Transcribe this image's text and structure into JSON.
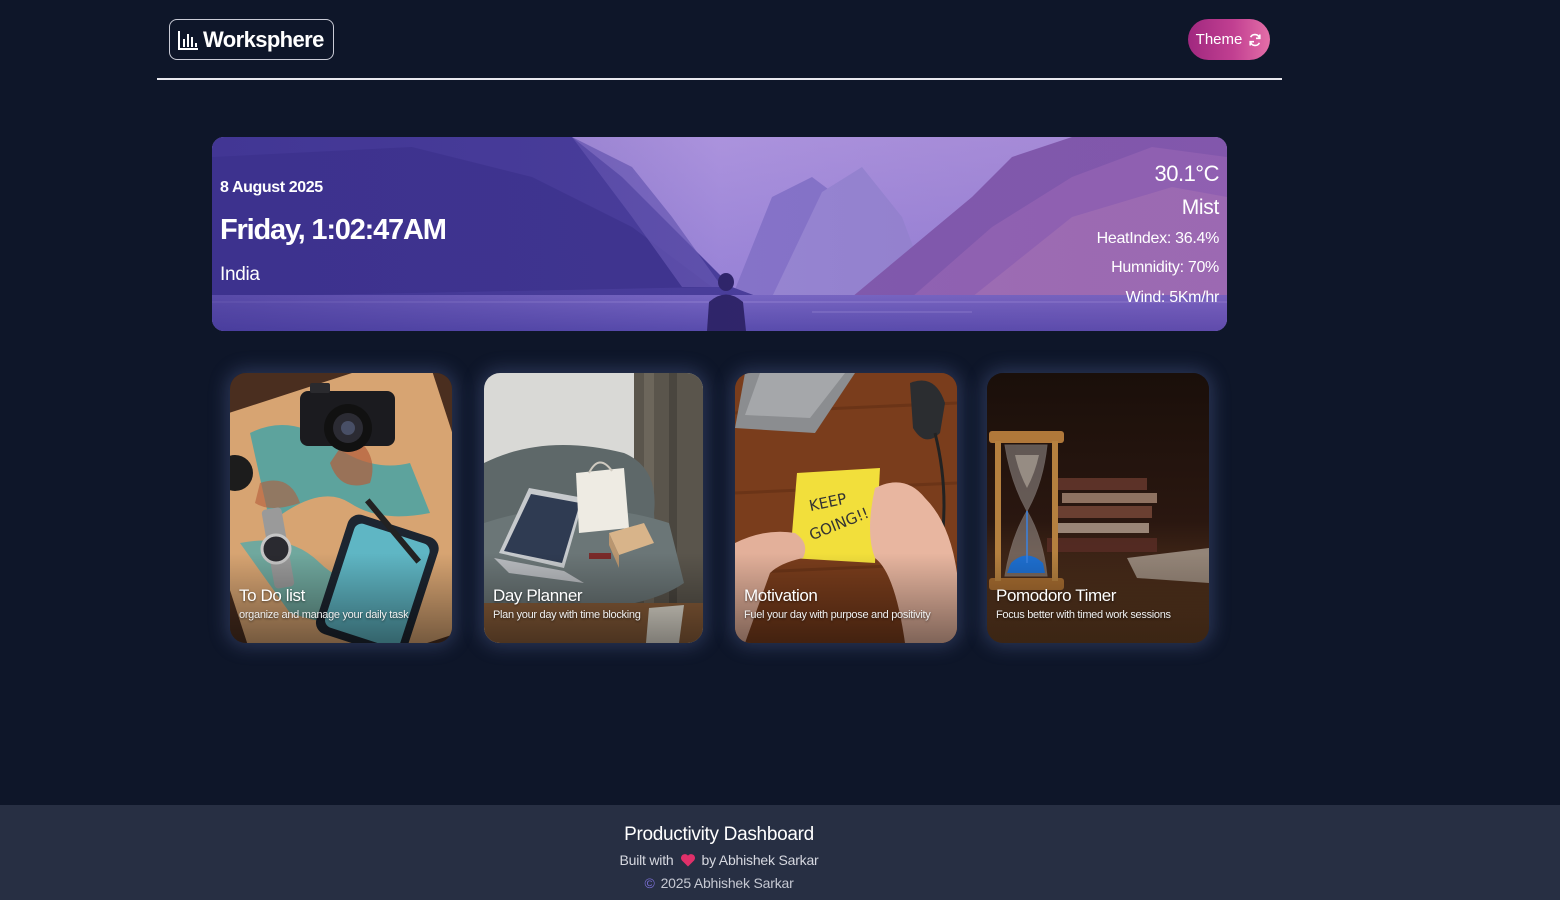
{
  "header": {
    "logo_text": "Worksphere",
    "logo_icon": "bar-chart-icon",
    "theme_label": "Theme",
    "theme_icon": "refresh-icon",
    "theme_gradient": [
      "#a0287f",
      "#e46fa8"
    ]
  },
  "hero": {
    "date": "8 August 2025",
    "time": "Friday, 1:02:47AM",
    "location": "India",
    "weather": {
      "temperature": "30.1°C",
      "condition": "Mist",
      "heat_index": "HeatIndex: 36.4%",
      "humidity": "Humnidity: 70%",
      "wind": "Wind: 5Km/hr"
    }
  },
  "cards": [
    {
      "title": "To Do list",
      "subtitle": "organize and manage your daily task"
    },
    {
      "title": "Day Planner",
      "subtitle": "Plan your day with time blocking"
    },
    {
      "title": "Motivation",
      "subtitle": "Fuel your day with purpose and positivity"
    },
    {
      "title": "Pomodoro Timer",
      "subtitle": "Focus better with timed work sessions"
    }
  ],
  "footer": {
    "title": "Productivity Dashboard",
    "built_prefix": "Built with",
    "built_suffix": "by Abhishek Sarkar",
    "heart_icon": "heart-icon",
    "copyright_symbol": "©",
    "copyright_text": "2025 Abhishek Sarkar"
  },
  "colors": {
    "background": "#0e1629",
    "footer_background": "#272f43",
    "accent_copyright": "#7b6fd6",
    "heart": "#e0306a"
  }
}
